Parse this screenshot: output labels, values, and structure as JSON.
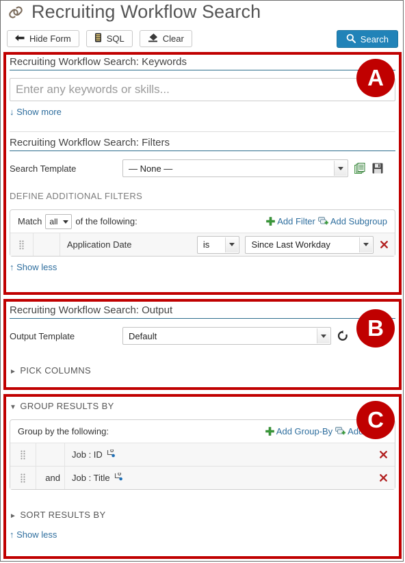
{
  "header": {
    "icon": "link-icon",
    "title": "Recruiting Workflow Search"
  },
  "toolbar": {
    "hide_form": "Hide Form",
    "sql": "SQL",
    "clear": "Clear",
    "search": "Search"
  },
  "annotations": [
    {
      "label": "A"
    },
    {
      "label": "B"
    },
    {
      "label": "C"
    }
  ],
  "keywords_section": {
    "title": "Recruiting Workflow Search: Keywords",
    "input_placeholder": "Enter any keywords or skills...",
    "input_value": "",
    "show_more": "↓ Show more"
  },
  "filters_section": {
    "title": "Recruiting Workflow Search: Filters",
    "template_label": "Search Template",
    "template_value": "— None —",
    "copy_icon": "copy-icon",
    "save_icon": "save-icon",
    "define_heading": "DEFINE ADDITIONAL FILTERS",
    "match_prefix": "Match",
    "match_value": "all",
    "match_suffix": "of the following:",
    "add_filter": "Add Filter",
    "add_subgroup": "Add Subgroup",
    "rows": [
      {
        "conjunction": "",
        "field": "Application Date",
        "operator": "is",
        "value": "Since Last Workday"
      }
    ],
    "show_less": "↑ Show less"
  },
  "output_section": {
    "title": "Recruiting Workflow Search: Output",
    "template_label": "Output Template",
    "template_value": "Default",
    "refresh_icon": "refresh-icon",
    "pick_columns": "PICK COLUMNS"
  },
  "group_section": {
    "heading": "GROUP RESULTS BY",
    "group_by_label": "Group by the following:",
    "add_group_by": "Add Group-By",
    "add_level": "Add Level",
    "rows": [
      {
        "conjunction": "",
        "field": "Job : ID"
      },
      {
        "conjunction": "and",
        "field": "Job : Title"
      }
    ]
  },
  "sort_section": {
    "heading": "SORT RESULTS BY"
  },
  "footer": {
    "show_less": "↑ Show less"
  },
  "colors": {
    "annotation_red": "#c00000",
    "search_blue": "#2183b8",
    "link_blue": "#2e6e9e",
    "section_rule": "#2e6e8e",
    "delete_red": "#b22222",
    "add_green": "#3a9a3a"
  }
}
